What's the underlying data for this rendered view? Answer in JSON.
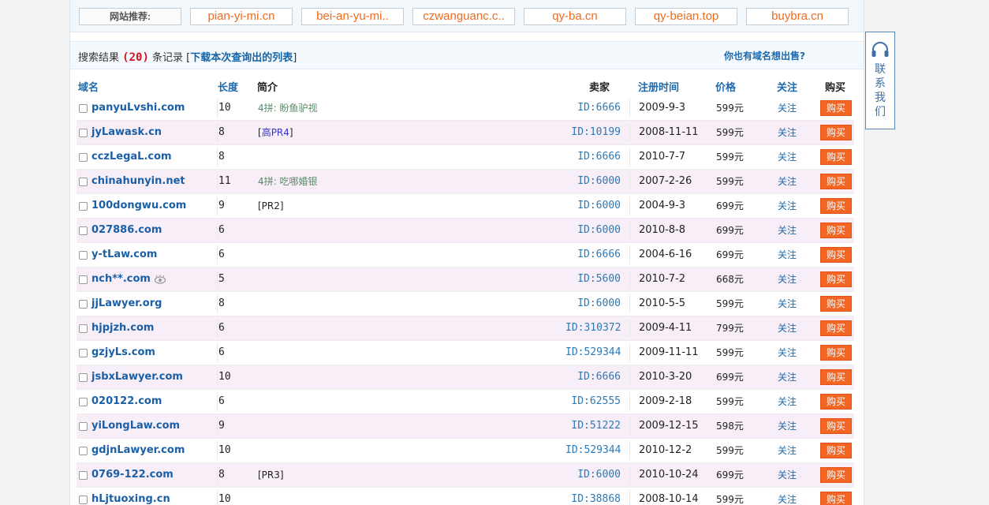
{
  "recommend": {
    "label": "网站推荐:",
    "sites": [
      "pian-yi-mi.cn",
      "bei-an-yu-mi..",
      "czwanguanc.c..",
      "qy-ba.cn",
      "qy-beian.top",
      "buybra.cn"
    ]
  },
  "results": {
    "prefix": "搜索结果",
    "count": "(20)",
    "middle": "条记录 [",
    "download_link": "下载本次查询出的列表",
    "suffix": "]",
    "sell_prompt": "你也有域名想出售?"
  },
  "columns": {
    "domain": "域名",
    "length": "长度",
    "intro": "简介",
    "seller": "卖家",
    "reg_time": "注册时间",
    "price": "价格",
    "follow": "关注",
    "buy": "购买"
  },
  "rows": [
    {
      "domain": "panyuLvshi.com",
      "length": "10",
      "intro_text": "4拼: 盼鱼驴视",
      "seller": "ID:6666",
      "date": "2009-9-3",
      "price": "599元",
      "follow": "关注",
      "buy": "购买"
    },
    {
      "domain": "jyLawask.cn",
      "length": "8",
      "intro_open": "[",
      "intro_pr": "高PR4",
      "intro_close": "]",
      "seller": "ID:10199",
      "date": "2008-11-11",
      "price": "599元",
      "follow": "关注",
      "buy": "购买"
    },
    {
      "domain": "cczLegaL.com",
      "length": "8",
      "seller": "ID:6666",
      "date": "2010-7-7",
      "price": "599元",
      "follow": "关注",
      "buy": "购买"
    },
    {
      "domain": "chinahunyin.net",
      "length": "11",
      "intro_text": "4拼: 吃哪婚银",
      "seller": "ID:6000",
      "date": "2007-2-26",
      "price": "599元",
      "follow": "关注",
      "buy": "购买"
    },
    {
      "domain": "100dongwu.com",
      "length": "9",
      "intro_tag": "[PR2]",
      "seller": "ID:6000",
      "date": "2004-9-3",
      "price": "699元",
      "follow": "关注",
      "buy": "购买"
    },
    {
      "domain": "027886.com",
      "length": "6",
      "seller": "ID:6000",
      "date": "2010-8-8",
      "price": "699元",
      "follow": "关注",
      "buy": "购买"
    },
    {
      "domain": "y-tLaw.com",
      "length": "6",
      "seller": "ID:6666",
      "date": "2004-6-16",
      "price": "699元",
      "follow": "关注",
      "buy": "购买"
    },
    {
      "domain": "nch**.com",
      "watch": true,
      "length": "5",
      "seller": "ID:5600",
      "date": "2010-7-2",
      "price": "668元",
      "follow": "关注",
      "buy": "购买"
    },
    {
      "domain": "jjLawyer.org",
      "length": "8",
      "seller": "ID:6000",
      "date": "2010-5-5",
      "price": "599元",
      "follow": "关注",
      "buy": "购买"
    },
    {
      "domain": "hjpjzh.com",
      "length": "6",
      "seller": "ID:310372",
      "date": "2009-4-11",
      "price": "799元",
      "follow": "关注",
      "buy": "购买"
    },
    {
      "domain": "gzjyLs.com",
      "length": "6",
      "seller": "ID:529344",
      "date": "2009-11-11",
      "price": "599元",
      "follow": "关注",
      "buy": "购买"
    },
    {
      "domain": "jsbxLawyer.com",
      "length": "10",
      "seller": "ID:6666",
      "date": "2010-3-20",
      "price": "699元",
      "follow": "关注",
      "buy": "购买"
    },
    {
      "domain": "020122.com",
      "length": "6",
      "seller": "ID:62555",
      "date": "2009-2-18",
      "price": "599元",
      "follow": "关注",
      "buy": "购买"
    },
    {
      "domain": "yiLongLaw.com",
      "length": "9",
      "seller": "ID:51222",
      "date": "2009-12-15",
      "price": "598元",
      "follow": "关注",
      "buy": "购买"
    },
    {
      "domain": "gdjnLawyer.com",
      "length": "10",
      "seller": "ID:529344",
      "date": "2010-12-2",
      "price": "599元",
      "follow": "关注",
      "buy": "购买"
    },
    {
      "domain": "0769-122.com",
      "length": "8",
      "intro_tag": "[PR3]",
      "seller": "ID:6000",
      "date": "2010-10-24",
      "price": "699元",
      "follow": "关注",
      "buy": "购买"
    },
    {
      "domain": "hLjtuoxing.cn",
      "length": "10",
      "seller": "ID:38868",
      "date": "2008-10-14",
      "price": "599元",
      "follow": "关注",
      "buy": "购买"
    }
  ],
  "contact": {
    "chars": [
      "联",
      "系",
      "我",
      "们"
    ]
  },
  "icons": {
    "contact": "headset-icon",
    "watch": "eye-icon"
  },
  "colors": {
    "accent": "#f26522",
    "link": "#1e6aab",
    "count": "#d0161d",
    "alt_row": "#f7eef7"
  }
}
